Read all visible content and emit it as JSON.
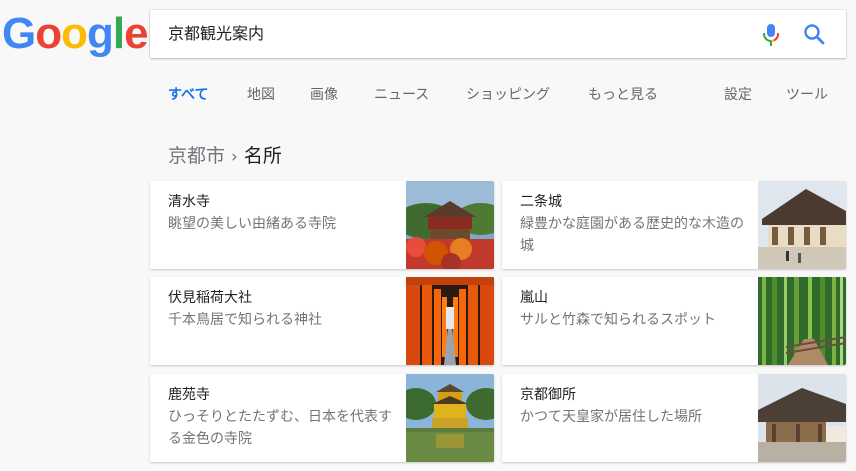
{
  "logo": {
    "letters": [
      "G",
      "o",
      "o",
      "g",
      "l",
      "e"
    ],
    "colors": [
      "#4285F4",
      "#EA4335",
      "#FBBC05",
      "#4285F4",
      "#34A853",
      "#EA4335"
    ]
  },
  "search": {
    "value": "京都観光案内",
    "mic_icon": "mic-icon",
    "search_icon": "search-icon"
  },
  "tabs": [
    {
      "label": "すべて",
      "active": true
    },
    {
      "label": "地図",
      "active": false
    },
    {
      "label": "画像",
      "active": false
    },
    {
      "label": "ニュース",
      "active": false
    },
    {
      "label": "ショッピング",
      "active": false
    },
    {
      "label": "もっと見る",
      "active": false
    },
    {
      "label": "設定",
      "active": false
    },
    {
      "label": "ツール",
      "active": false
    }
  ],
  "breadcrumb": {
    "parent": "京都市",
    "separator": "›",
    "current": "名所"
  },
  "places": [
    {
      "title": "清水寺",
      "description": "眺望の美しい由緒ある寺院",
      "image": "kiyomizu-temple-photo"
    },
    {
      "title": "二条城",
      "description": "緑豊かな庭園がある歴史的な木造の城",
      "image": "nijo-castle-photo"
    },
    {
      "title": "伏見稲荷大社",
      "description": "千本鳥居で知られる神社",
      "image": "fushimi-inari-torii-photo"
    },
    {
      "title": "嵐山",
      "description": "サルと竹森で知られるスポット",
      "image": "arashiyama-bamboo-photo"
    },
    {
      "title": "鹿苑寺",
      "description": "ひっそりとたたずむ、日本を代表する金色の寺院",
      "image": "kinkakuji-photo"
    },
    {
      "title": "京都御所",
      "description": "かつて天皇家が居住した場所",
      "image": "imperial-palace-photo"
    }
  ],
  "colors": {
    "accent": "#1a73e8",
    "text_secondary": "#70757a",
    "background": "#f8f8f8"
  }
}
